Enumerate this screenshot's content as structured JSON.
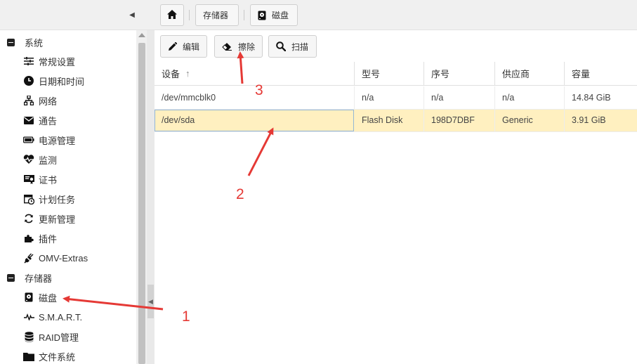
{
  "breadcrumb": {
    "home_icon": "home-icon",
    "storage": "存储器",
    "disks": "磁盘"
  },
  "sidebar": {
    "groups": [
      {
        "label": "系统",
        "items": [
          {
            "label": "常规设置",
            "icon": "sliders-icon"
          },
          {
            "label": "日期和时间",
            "icon": "clock-icon"
          },
          {
            "label": "网络",
            "icon": "network-icon"
          },
          {
            "label": "通告",
            "icon": "envelope-icon"
          },
          {
            "label": "电源管理",
            "icon": "battery-icon"
          },
          {
            "label": "监测",
            "icon": "heartbeat-icon"
          },
          {
            "label": "证书",
            "icon": "certificate-icon"
          },
          {
            "label": "计划任务",
            "icon": "calendar-clock-icon"
          },
          {
            "label": "更新管理",
            "icon": "refresh-icon"
          },
          {
            "label": "插件",
            "icon": "puzzle-icon"
          },
          {
            "label": "OMV-Extras",
            "icon": "plug-icon"
          }
        ]
      },
      {
        "label": "存储器",
        "items": [
          {
            "label": "磁盘",
            "icon": "hdd-icon"
          },
          {
            "label": "S.M.A.R.T.",
            "icon": "pulse-icon"
          },
          {
            "label": "RAID管理",
            "icon": "database-icon"
          },
          {
            "label": "文件系统",
            "icon": "folder-icon"
          }
        ]
      }
    ]
  },
  "toolbar": {
    "edit": "编辑",
    "wipe": "擦除",
    "scan": "扫描"
  },
  "table": {
    "columns": [
      "设备",
      "型号",
      "序号",
      "供应商",
      "容量"
    ],
    "rows": [
      [
        "/dev/mmcblk0",
        "n/a",
        "n/a",
        "n/a",
        "14.84 GiB"
      ],
      [
        "/dev/sda",
        "Flash Disk",
        "198D7DBF",
        "Generic",
        "3.91 GiB"
      ]
    ],
    "sort_indicator": "↑"
  },
  "annotations": {
    "n1": "1",
    "n2": "2",
    "n3": "3",
    "color": "#e53935"
  },
  "colors": {
    "selected_row": "#fff0c0",
    "topbar": "#f0f0f0"
  }
}
